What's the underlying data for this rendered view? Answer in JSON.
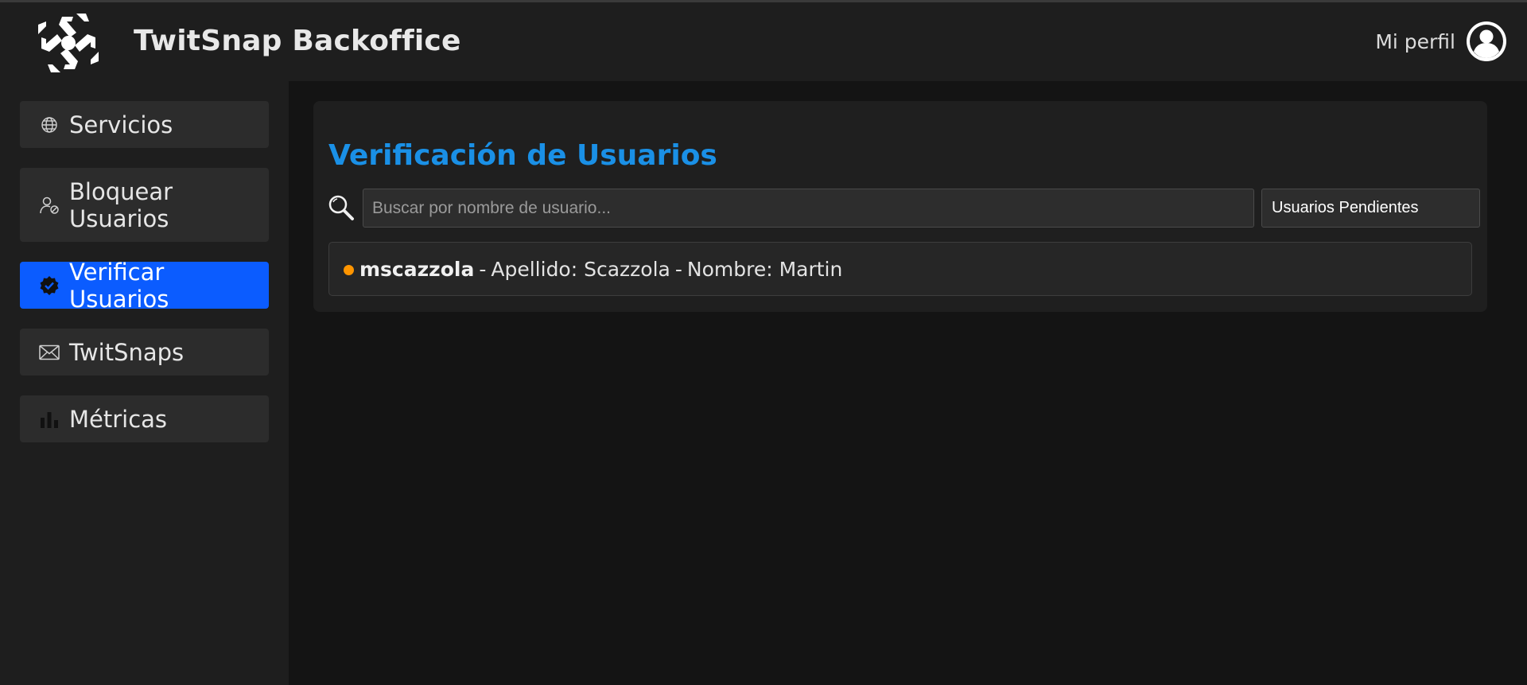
{
  "header": {
    "app_title": "TwitSnap Backoffice",
    "profile_label": "Mi perfil"
  },
  "sidebar": {
    "items": [
      {
        "label": "Servicios",
        "icon": "globe-icon",
        "active": false
      },
      {
        "label": "Bloquear Usuarios",
        "icon": "user-block-icon",
        "active": false
      },
      {
        "label": "Verificar Usuarios",
        "icon": "verified-badge-icon",
        "active": true
      },
      {
        "label": "TwitSnaps",
        "icon": "envelope-icon",
        "active": false
      },
      {
        "label": "Métricas",
        "icon": "bar-chart-icon",
        "active": false
      }
    ]
  },
  "main": {
    "title": "Verificación de Usuarios",
    "search": {
      "placeholder": "Buscar por nombre de usuario...",
      "value": ""
    },
    "filter": {
      "selected": "Usuarios Pendientes"
    },
    "users": [
      {
        "username": "mscazzola",
        "apellido_label": "Apellido: Scazzola",
        "nombre_label": "Nombre: Martin",
        "status_color": "#ff9500"
      }
    ]
  },
  "colors": {
    "accent": "#0b5cff",
    "title": "#1a90e6",
    "pending": "#ff9500"
  }
}
